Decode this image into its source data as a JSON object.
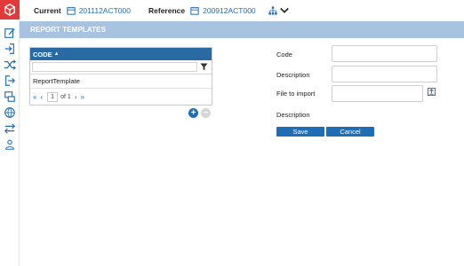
{
  "topbar": {
    "current_label": "Current",
    "current_value": "201112ACT000",
    "reference_label": "Reference",
    "reference_value": "200912ACT000"
  },
  "page": {
    "title": "REPORT TEMPLATES"
  },
  "grid": {
    "column_header": "CODE",
    "sort_indicator": "▲",
    "rows": [
      {
        "code": "ReportTemplate"
      }
    ],
    "pager": {
      "page": "1",
      "of_text": "of 1"
    }
  },
  "form": {
    "code_label": "Code",
    "description_label": "Description",
    "file_label": "File to import",
    "description2_label": "Description",
    "code_value": "",
    "description_value": "",
    "file_value": ""
  },
  "buttons": {
    "save": "Save",
    "cancel": "Cancel"
  },
  "colors": {
    "accent": "#1f6db4",
    "brand": "#e23a3a",
    "band": "#a7c3e0",
    "grid_header": "#2a6aa4"
  },
  "icons": [
    "logo-icon",
    "edit-icon",
    "login-icon",
    "shuffle-icon",
    "logout-icon",
    "monitor-icon",
    "globe-icon",
    "swap-icon",
    "users-icon",
    "calendar-icon",
    "hierarchy-icon",
    "chevron-down-icon",
    "filter-icon",
    "upload-icon",
    "plus-icon",
    "minus-icon"
  ]
}
